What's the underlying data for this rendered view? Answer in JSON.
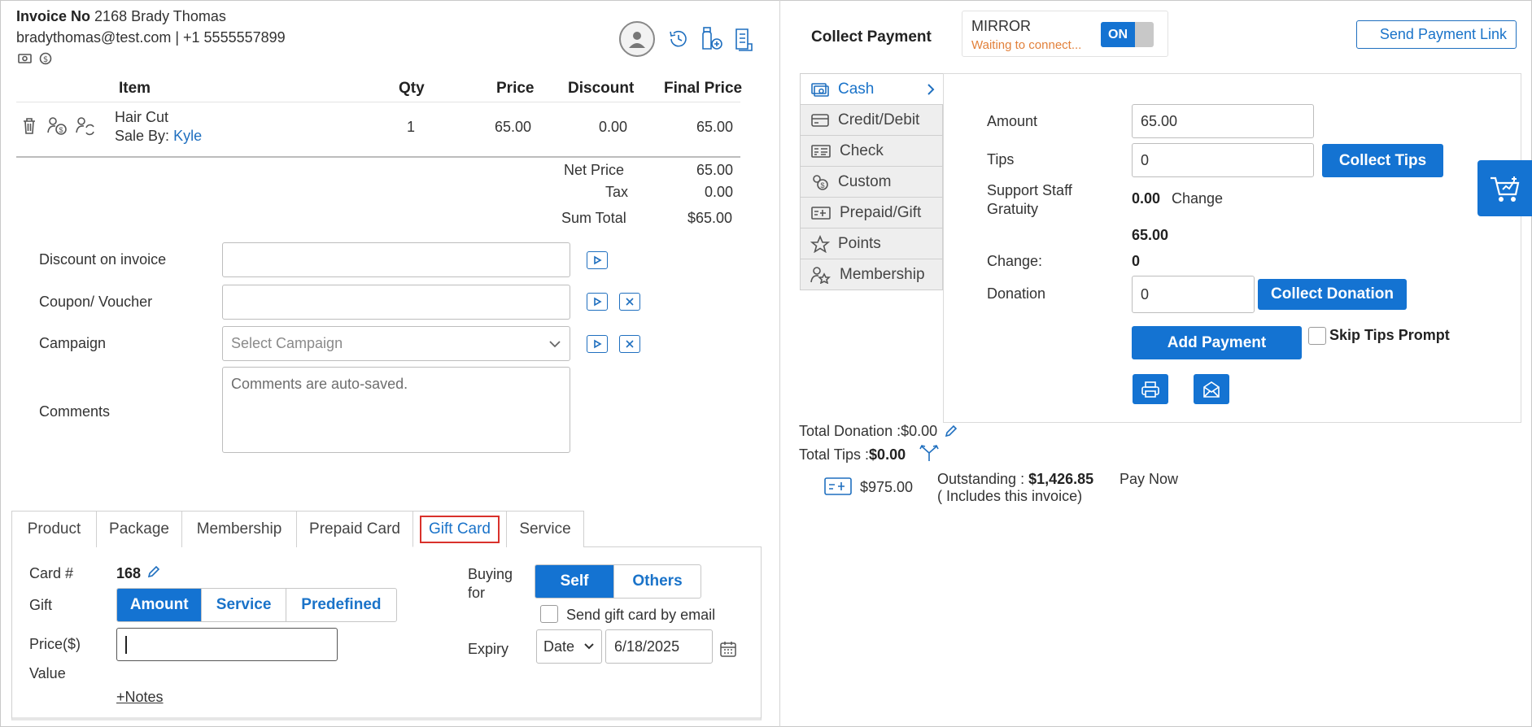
{
  "invoice": {
    "label": "Invoice No",
    "number": "2168",
    "customer": "Brady Thomas",
    "contact": "bradythomas@test.com | +1 5555557899"
  },
  "table": {
    "headers": {
      "item": "Item",
      "qty": "Qty",
      "price": "Price",
      "discount": "Discount",
      "final": "Final Price"
    },
    "rows": [
      {
        "item": "Hair Cut",
        "sale_by_label": "Sale By:",
        "sale_by": "Kyle",
        "qty": "1",
        "price": "65.00",
        "discount": "0.00",
        "final": "65.00"
      }
    ]
  },
  "totals": {
    "net_label": "Net Price",
    "net": "65.00",
    "tax_label": "Tax",
    "tax": "0.00",
    "sum_label": "Sum Total",
    "sum": "$65.00"
  },
  "form": {
    "discount_label": "Discount on invoice",
    "coupon_label": "Coupon/ Voucher",
    "campaign_label": "Campaign",
    "campaign_placeholder": "Select Campaign",
    "comments_label": "Comments",
    "comments_placeholder": "Comments are auto-saved."
  },
  "tabs": [
    "Product",
    "Package",
    "Membership",
    "Prepaid Card",
    "Gift Card",
    "Service"
  ],
  "gift": {
    "card_label": "Card #",
    "card_number": "168",
    "gift_label": "Gift",
    "gift_options": [
      "Amount",
      "Service",
      "Predefined"
    ],
    "price_label": "Price($)",
    "value_label": "Value",
    "notes_link": "+Notes",
    "buying_label": "Buying for",
    "buying_options": [
      "Self",
      "Others"
    ],
    "email_label": "Send gift card by email",
    "expiry_label": "Expiry",
    "expiry_type": "Date",
    "expiry_date": "6/18/2025"
  },
  "payment": {
    "title": "Collect Payment",
    "mirror_label": "MIRROR",
    "mirror_status": "Waiting to connect...",
    "mirror_toggle": "ON",
    "send_link": "Send Payment Link",
    "methods": [
      "Cash",
      "Credit/Debit",
      "Check",
      "Custom",
      "Prepaid/Gift",
      "Points",
      "Membership"
    ],
    "amount_label": "Amount",
    "amount": "65.00",
    "tips_label": "Tips",
    "tips": "0",
    "collect_tips": "Collect Tips",
    "support_label": "Support Staff Gratuity",
    "support_value": "0.00",
    "change_link": "Change",
    "subtotal": "65.00",
    "change_label": "Change:",
    "change_value": "0",
    "donation_label": "Donation",
    "donation": "0",
    "collect_donation": "Collect Donation",
    "add_payment": "Add Payment",
    "skip_tips": "Skip Tips Prompt",
    "total_donation": "Total Donation :$0.00",
    "total_tips_label": "Total Tips :",
    "total_tips": "$0.00",
    "prepaid_balance": "$975.00",
    "outstanding_label": "Outstanding :",
    "outstanding": "$1,426.85",
    "outstanding_note": "( Includes this invoice)",
    "pay_now": "Pay Now"
  },
  "colors": {
    "accent": "#1473d2",
    "link": "#1f6fbf",
    "highlight": "#d9312b"
  }
}
